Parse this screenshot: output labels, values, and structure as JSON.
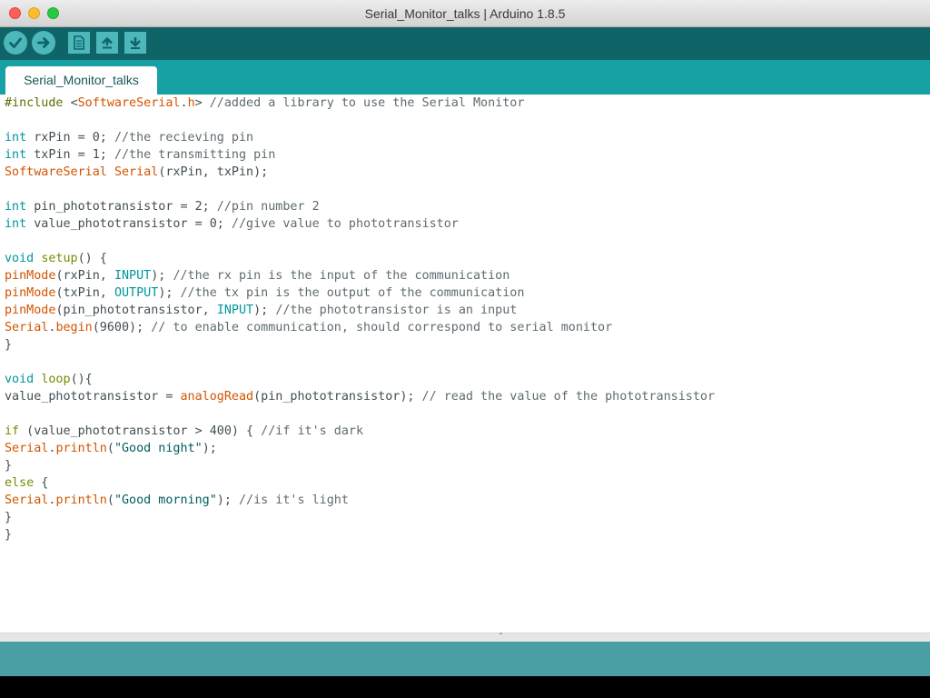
{
  "window": {
    "title": "Serial_Monitor_talks | Arduino 1.8.5"
  },
  "toolbar": {
    "verify_icon": "checkmark-icon",
    "upload_icon": "right-arrow-icon",
    "new_icon": "new-file-icon",
    "open_icon": "up-arrow-icon",
    "save_icon": "down-arrow-icon"
  },
  "tabs": [
    {
      "label": "Serial_Monitor_talks"
    }
  ],
  "colors": {
    "toolbar": "#0f6468",
    "tabbar": "#17a1a5",
    "button": "#4db7bb",
    "type": "#00979c",
    "function": "#d35400",
    "comment": "#5f6b70",
    "string": "#005c5f"
  },
  "code": [
    [
      [
        "pre",
        "#include "
      ],
      [
        "text",
        "<"
      ],
      [
        "func",
        "SoftwareSerial"
      ],
      [
        "text",
        "."
      ],
      [
        "func",
        "h"
      ],
      [
        "text",
        "> "
      ],
      [
        "comment",
        "//added a library to use the Serial Monitor"
      ]
    ],
    [],
    [
      [
        "type",
        "int"
      ],
      [
        "text",
        " rxPin = 0; "
      ],
      [
        "comment",
        "//the recieving pin"
      ]
    ],
    [
      [
        "type",
        "int"
      ],
      [
        "text",
        " txPin = 1; "
      ],
      [
        "comment",
        "//the transmitting pin"
      ]
    ],
    [
      [
        "func",
        "SoftwareSerial"
      ],
      [
        "text",
        " "
      ],
      [
        "func",
        "Serial"
      ],
      [
        "text",
        "(rxPin, txPin);"
      ]
    ],
    [],
    [
      [
        "type",
        "int"
      ],
      [
        "text",
        " pin_phototransistor = 2; "
      ],
      [
        "comment",
        "//pin number 2"
      ]
    ],
    [
      [
        "type",
        "int"
      ],
      [
        "text",
        " value_phototransistor = 0; "
      ],
      [
        "comment",
        "//give value to phototransistor"
      ]
    ],
    [],
    [
      [
        "type",
        "void"
      ],
      [
        "text",
        " "
      ],
      [
        "kw",
        "setup"
      ],
      [
        "text",
        "() {"
      ]
    ],
    [
      [
        "func",
        "pinMode"
      ],
      [
        "text",
        "(rxPin, "
      ],
      [
        "const",
        "INPUT"
      ],
      [
        "text",
        "); "
      ],
      [
        "comment",
        "//the rx pin is the input of the communication"
      ]
    ],
    [
      [
        "func",
        "pinMode"
      ],
      [
        "text",
        "(txPin, "
      ],
      [
        "const",
        "OUTPUT"
      ],
      [
        "text",
        "); "
      ],
      [
        "comment",
        "//the tx pin is the output of the communication"
      ]
    ],
    [
      [
        "func",
        "pinMode"
      ],
      [
        "text",
        "(pin_phototransistor, "
      ],
      [
        "const",
        "INPUT"
      ],
      [
        "text",
        "); "
      ],
      [
        "comment",
        "//the phototransistor is an input"
      ]
    ],
    [
      [
        "func",
        "Serial"
      ],
      [
        "text",
        "."
      ],
      [
        "func",
        "begin"
      ],
      [
        "text",
        "(9600); "
      ],
      [
        "comment",
        "// to enable communication, should correspond to serial monitor"
      ]
    ],
    [
      [
        "text",
        "}"
      ]
    ],
    [],
    [
      [
        "type",
        "void"
      ],
      [
        "text",
        " "
      ],
      [
        "kw",
        "loop"
      ],
      [
        "text",
        "(){"
      ]
    ],
    [
      [
        "text",
        "value_phototransistor = "
      ],
      [
        "func",
        "analogRead"
      ],
      [
        "text",
        "(pin_phototransistor); "
      ],
      [
        "comment",
        "// read the value of the phototransistor"
      ]
    ],
    [],
    [
      [
        "kw",
        "if"
      ],
      [
        "text",
        " (value_phototransistor > 400) { "
      ],
      [
        "comment",
        "//if it's dark"
      ]
    ],
    [
      [
        "func",
        "Serial"
      ],
      [
        "text",
        "."
      ],
      [
        "func",
        "println"
      ],
      [
        "text",
        "("
      ],
      [
        "string",
        "\"Good night\""
      ],
      [
        "text",
        ");"
      ]
    ],
    [
      [
        "text",
        "}"
      ]
    ],
    [
      [
        "kw",
        "else"
      ],
      [
        "text",
        " {"
      ]
    ],
    [
      [
        "func",
        "Serial"
      ],
      [
        "text",
        "."
      ],
      [
        "func",
        "println"
      ],
      [
        "text",
        "("
      ],
      [
        "string",
        "\"Good morning\""
      ],
      [
        "text",
        "); "
      ],
      [
        "comment",
        "//is it's light"
      ]
    ],
    [
      [
        "text",
        "}"
      ]
    ],
    [
      [
        "text",
        "}"
      ]
    ]
  ]
}
